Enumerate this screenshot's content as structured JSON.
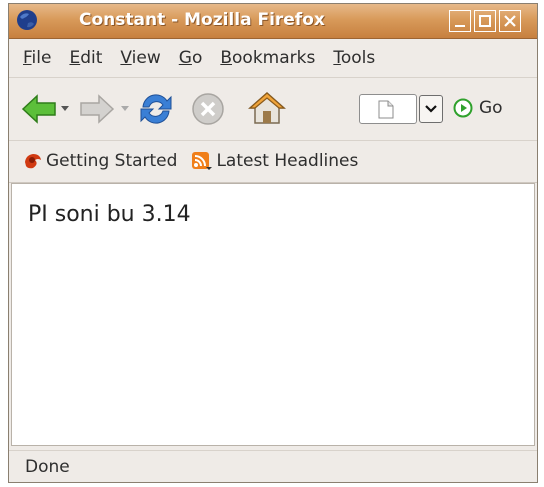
{
  "window": {
    "title": "Constant - Mozilla Firefox"
  },
  "menu": {
    "items": [
      {
        "mnemonic": "F",
        "rest": "ile"
      },
      {
        "mnemonic": "E",
        "rest": "dit"
      },
      {
        "mnemonic": "V",
        "rest": "iew"
      },
      {
        "mnemonic": "G",
        "rest": "o"
      },
      {
        "mnemonic": "B",
        "rest": "ookmarks"
      },
      {
        "mnemonic": "T",
        "rest": "ools"
      }
    ]
  },
  "toolbar": {
    "go_label": "Go",
    "icons": [
      "back-arrow-icon",
      "forward-arrow-icon",
      "reload-icon",
      "stop-icon",
      "home-icon",
      "page-icon",
      "dropdown-icon",
      "go-icon"
    ]
  },
  "bookmarks": {
    "items": [
      {
        "label": "Getting Started",
        "icon": "firefox-bookmark-icon"
      },
      {
        "label": "Latest Headlines",
        "icon": "rss-feed-icon"
      }
    ]
  },
  "content": {
    "text": "PI soni bu 3.14"
  },
  "status": {
    "text": "Done"
  },
  "colors": {
    "titlebar": "#d89a5a",
    "chrome": "#efebe7",
    "back_arrow": "#4caf2a",
    "reload": "#3a7fd5",
    "go": "#2fa12c",
    "rss": "#f07f1a"
  }
}
